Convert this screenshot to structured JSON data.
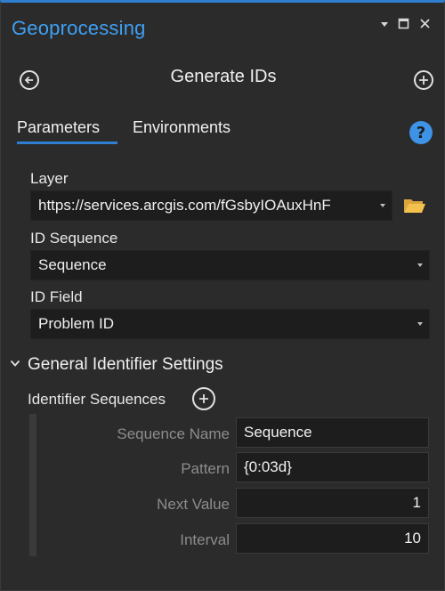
{
  "pane": {
    "title": "Geoprocessing"
  },
  "tool": {
    "title": "Generate IDs"
  },
  "tabs": [
    {
      "label": "Parameters",
      "active": true
    },
    {
      "label": "Environments",
      "active": false
    }
  ],
  "help": {
    "glyph": "?"
  },
  "parameters": {
    "layer": {
      "label": "Layer",
      "value": "https://services.arcgis.com/fGsbyIOAuxHnF"
    },
    "id_sequence": {
      "label": "ID Sequence",
      "value": "Sequence"
    },
    "id_field": {
      "label": "ID Field",
      "value": "Problem ID"
    }
  },
  "section": {
    "title": "General Identifier Settings",
    "expanded": true,
    "identifier_sequences_label": "Identifier Sequences",
    "fields": {
      "sequence_name": {
        "label": "Sequence Name",
        "value": "Sequence"
      },
      "pattern": {
        "label": "Pattern",
        "value": "{0:03d}"
      },
      "next_value": {
        "label": "Next Value",
        "value": "1"
      },
      "interval": {
        "label": "Interval",
        "value": "10"
      }
    }
  },
  "colors": {
    "accent": "#2e7fd0",
    "title": "#3ea0f5",
    "background": "#2b2b2b",
    "field": "#1d1d1d",
    "folder": "#f2c14e"
  },
  "icons": {
    "pin": "pin-dropdown-icon",
    "maximize": "maximize-icon",
    "close": "close-icon",
    "back": "back-arrow-icon",
    "add": "add-icon",
    "help": "help-icon",
    "folder": "folder-icon",
    "chevron": "chevron-down-icon"
  }
}
